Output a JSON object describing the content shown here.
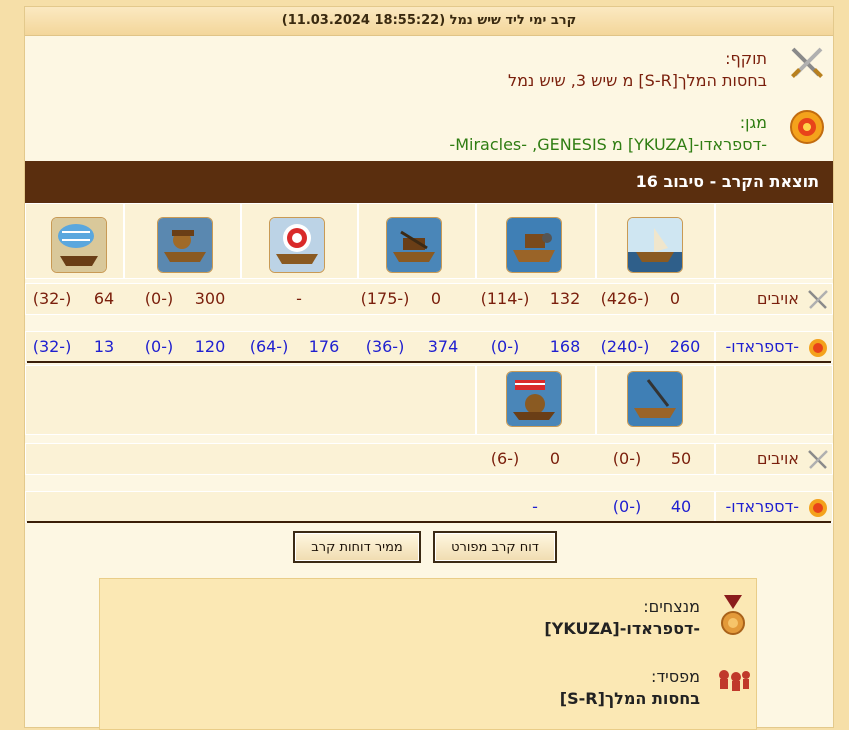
{
  "report": {
    "title": "קרב ימי ליד שיש נמל (18:55:22 11.03.2024)"
  },
  "attacker": {
    "role": "תוקף:",
    "names": "בחסות המלך[S-R] מ שיש 3, שיש נמל"
  },
  "defender": {
    "role": "מגן:",
    "names": "-דספראדו-[YKUZA] מ Miracles- ,GENESIS-"
  },
  "result": {
    "title": "תוצאת הקרב - סיבוב 16"
  },
  "row_labels": {
    "enemies": "אויבים",
    "defender": "-דספראדו-"
  },
  "block1": {
    "enemies": [
      {
        "val": "0",
        "loss": "(-426)"
      },
      {
        "val": "132",
        "loss": "(-114)"
      },
      {
        "val": "0",
        "loss": "(-175)"
      },
      {
        "val": "-",
        "loss": ""
      },
      {
        "val": "300",
        "loss": "(-0)"
      },
      {
        "val": "64",
        "loss": "(-32)"
      }
    ],
    "defender": [
      {
        "val": "260",
        "loss": "(-240)"
      },
      {
        "val": "168",
        "loss": "(-0)"
      },
      {
        "val": "374",
        "loss": "(-36)"
      },
      {
        "val": "176",
        "loss": "(-64)"
      },
      {
        "val": "120",
        "loss": "(-0)"
      },
      {
        "val": "13",
        "loss": "(-32)"
      }
    ]
  },
  "block2": {
    "enemies": [
      {
        "val": "50",
        "loss": "(-0)"
      },
      {
        "val": "0",
        "loss": "(-6)"
      }
    ],
    "defender": [
      {
        "val": "40",
        "loss": "(-0)"
      },
      {
        "val": "-",
        "loss": ""
      }
    ]
  },
  "buttons": {
    "detailed": "דוח קרב מפורט",
    "sorter": "ממיר דוחות קרב"
  },
  "summary": {
    "winners_title": "מנצחים:",
    "winners_name": "-דספראדו-[YKUZA]",
    "loser_title": "מפסיד:",
    "loser_name": "בחסות המלך[S-R]"
  },
  "icons": {
    "attacker": "crossed-swords-icon",
    "defender": "shield-icon",
    "winner": "medal-icon",
    "loser": "fallen-soldiers-icon"
  },
  "colors": {
    "header_bar": "#5a2e0e",
    "attacker_text": "#7a1f0c",
    "defender_text": "#2f7d12",
    "defender_numbers": "#1f1fd0",
    "background": "#f6dfa8"
  }
}
